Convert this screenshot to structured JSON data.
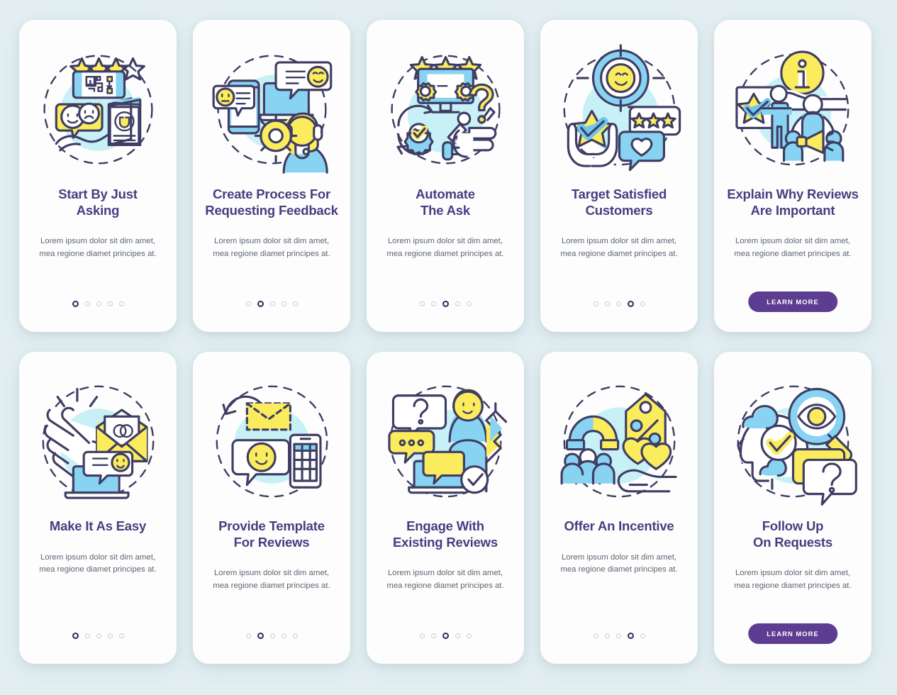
{
  "theme": {
    "background": "#e2eef1",
    "card_background": "#fdfdfd",
    "title_color": "#4a3c80",
    "body_color": "#5d6573",
    "accent_purple": "#5c3d91",
    "dot_active": "#2f2b5c",
    "dot_inactive": "#c9cdd6",
    "illustration_yellow": "#fbec5d",
    "illustration_blue": "#88d3f2",
    "illustration_blob": "#c7f0f7",
    "illustration_outline": "#3f3d63"
  },
  "shared": {
    "body_text": "Lorem ipsum dolor sit dim amet, mea regione diamet principes at.",
    "cta_label": "LEARN MORE",
    "dot_count": 5
  },
  "cards": [
    {
      "id": "start-by-just-asking",
      "title": "Start By Just Asking",
      "title_lines": [
        "Start By Just",
        "Asking"
      ],
      "body": "Lorem ipsum dolor sit dim amet, mea regione diamet principes at.",
      "active_dot": 1,
      "has_cta": false,
      "illustration": "qr-code-review-card-icon"
    },
    {
      "id": "create-process-for-requesting-feedback",
      "title": "Create Process For Requesting Feedback",
      "title_lines": [
        "Create Process For",
        "Requesting Feedback"
      ],
      "body": "Lorem ipsum dolor sit dim amet, mea regione diamet principes at.",
      "active_dot": 2,
      "has_cta": false,
      "illustration": "support-agent-devices-icon"
    },
    {
      "id": "automate-the-ask",
      "title": "Automate The Ask",
      "title_lines": [
        "Automate",
        "The Ask"
      ],
      "body": "Lorem ipsum dolor sit dim amet, mea regione diamet principes at.",
      "active_dot": 3,
      "has_cta": false,
      "illustration": "robot-arm-monitor-gear-icon"
    },
    {
      "id": "target-satisfied-customers",
      "title": "Target Satisfied Customers",
      "title_lines": [
        "Target Satisfied",
        "Customers"
      ],
      "body": "Lorem ipsum dolor sit dim amet, mea regione diamet principes at.",
      "active_dot": 4,
      "has_cta": false,
      "illustration": "target-smiley-hands-star-icon"
    },
    {
      "id": "explain-why-reviews-are-important",
      "title": "Explain Why Reviews Are Important",
      "title_lines": [
        "Explain Why Reviews",
        "Are Important"
      ],
      "body": "Lorem ipsum dolor sit dim amet, mea regione diamet principes at.",
      "active_dot": 0,
      "has_cta": true,
      "cta_label": "LEARN MORE",
      "illustration": "info-hand-presenter-megaphone-icon"
    },
    {
      "id": "make-it-as-easy",
      "title": "Make It As Easy",
      "title_lines": [
        "Make It As Easy"
      ],
      "body": "Lorem ipsum dolor sit dim amet, mea regione diamet principes at.",
      "active_dot": 1,
      "has_cta": false,
      "illustration": "click-hand-envelope-laptop-icon"
    },
    {
      "id": "provide-template-for-reviews",
      "title": "Provide Template For Reviews",
      "title_lines": [
        "Provide Template",
        "For Reviews"
      ],
      "body": "Lorem ipsum dolor sit dim amet, mea regione diamet principes at.",
      "active_dot": 2,
      "has_cta": false,
      "illustration": "envelope-chat-smiley-phone-icon"
    },
    {
      "id": "engage-with-existing-reviews",
      "title": "Engage With Existing Reviews",
      "title_lines": [
        "Engage With",
        "Existing Reviews"
      ],
      "body": "Lorem ipsum dolor sit dim amet, mea regione diamet principes at.",
      "active_dot": 3,
      "has_cta": false,
      "illustration": "person-question-chat-monitor-check-icon"
    },
    {
      "id": "offer-an-incentive",
      "title": "Offer An Incentive",
      "title_lines": [
        "Offer An Incentive"
      ],
      "body": "Lorem ipsum dolor sit dim amet, mea regione diamet principes at.",
      "active_dot": 4,
      "has_cta": false,
      "illustration": "magnet-discount-tag-hearts-icon"
    },
    {
      "id": "follow-up-on-requests",
      "title": "Follow Up On Requests",
      "title_lines": [
        "Follow Up",
        "On Requests"
      ],
      "body": "Lorem ipsum dolor sit dim amet, mea regione diamet principes at.",
      "active_dot": 0,
      "has_cta": true,
      "cta_label": "LEARN MORE",
      "illustration": "head-magnifier-eye-question-icon"
    }
  ]
}
